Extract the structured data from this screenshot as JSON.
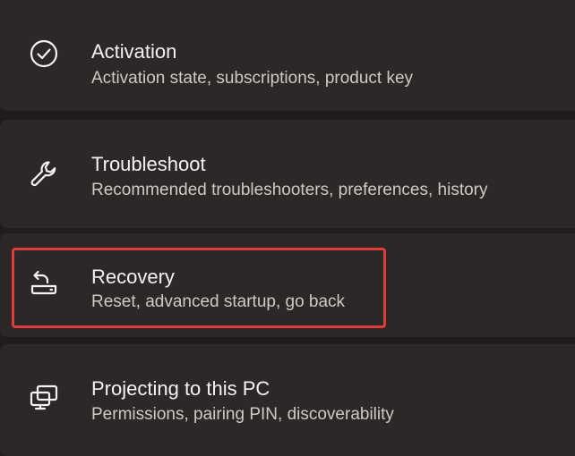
{
  "settings_list": {
    "items": [
      {
        "key": "activation",
        "icon": "checkmark-circle-icon",
        "title": "Activation",
        "subtitle": "Activation state, subscriptions, product key"
      },
      {
        "key": "troubleshoot",
        "icon": "wrench-icon",
        "title": "Troubleshoot",
        "subtitle": "Recommended troubleshooters, preferences, history"
      },
      {
        "key": "recovery",
        "icon": "recovery-drive-icon",
        "title": "Recovery",
        "subtitle": "Reset, advanced startup, go back",
        "highlighted": true
      },
      {
        "key": "projecting",
        "icon": "projecting-screens-icon",
        "title": "Projecting to this PC",
        "subtitle": "Permissions, pairing PIN, discoverability"
      }
    ]
  },
  "colors": {
    "background": "#1f1c1b",
    "card": "#2c2827",
    "title_text": "#f3f3f3",
    "subtitle_text": "#cfcac8",
    "highlight_border": "#e03c3c"
  }
}
